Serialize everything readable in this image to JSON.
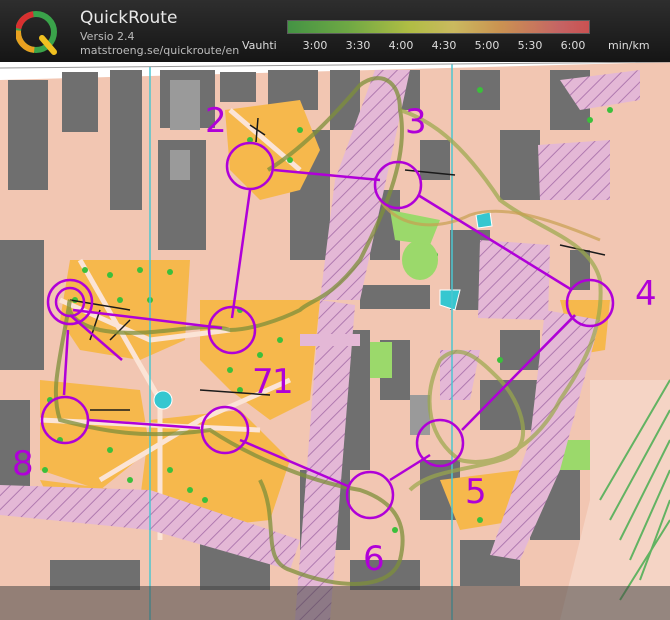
{
  "app": {
    "title": "QuickRoute",
    "version": "Versio 2.4",
    "url": "matstroeng.se/quickroute/en"
  },
  "pace_scale": {
    "label": "Vauhti",
    "ticks": [
      "3:00",
      "3:30",
      "4:00",
      "4:30",
      "5:00",
      "5:30",
      "6:00"
    ],
    "unit": "min/km"
  },
  "controls": [
    "1",
    "2",
    "3",
    "4",
    "5",
    "6",
    "7",
    "8"
  ],
  "colors": {
    "course": "#b000d8",
    "route": "#7a8a3a",
    "terrain_open": "#f5b54a",
    "paved": "#f2c4b0",
    "building": "#6d6d6d",
    "forbidden": "#d9a8c8"
  }
}
